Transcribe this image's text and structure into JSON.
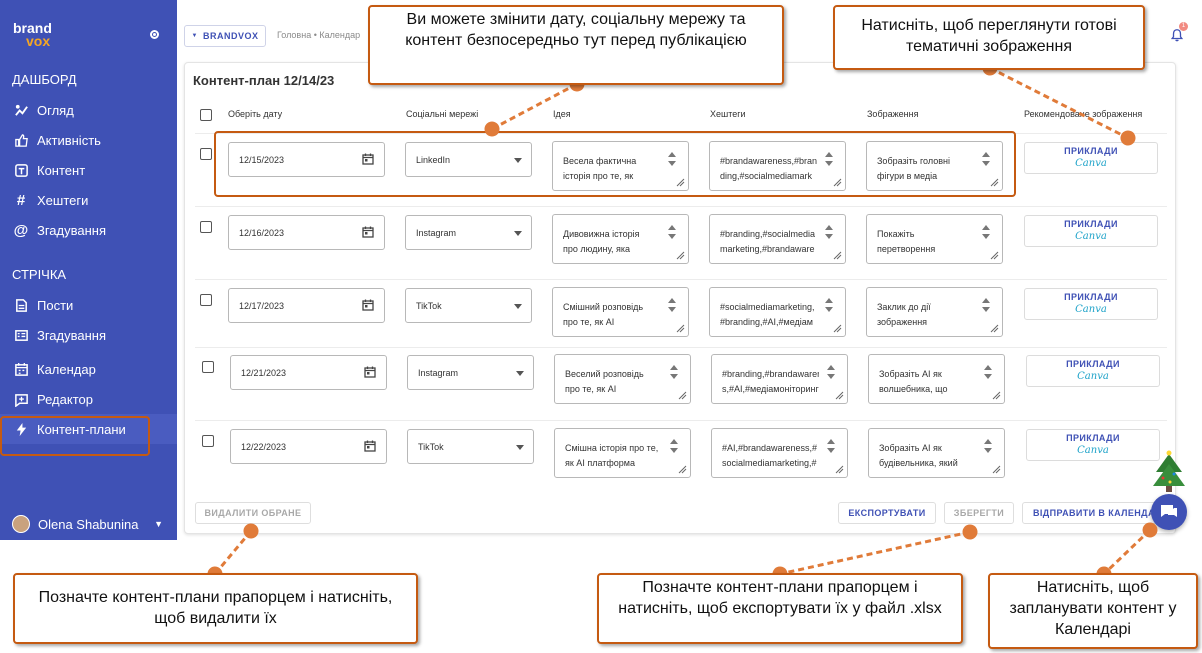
{
  "sidebar": {
    "logo_top": "brand",
    "logo_bottom": "vox",
    "section_dashboard": "ДАШБОРД",
    "section_feed": "СТРІЧКА",
    "items": [
      {
        "label": "Огляд",
        "icon": "overview-icon"
      },
      {
        "label": "Активність",
        "icon": "thumbs-up-icon"
      },
      {
        "label": "Контент",
        "icon": "content-icon"
      },
      {
        "label": "Хештеги",
        "icon": "hashtag-icon"
      },
      {
        "label": "Згадування",
        "icon": "at-icon"
      },
      {
        "label": "Пости",
        "icon": "posts-icon"
      },
      {
        "label": "Згадування",
        "icon": "mentions-list-icon"
      },
      {
        "label": "Календар",
        "icon": "calendar-icon"
      },
      {
        "label": "Редактор",
        "icon": "editor-icon"
      },
      {
        "label": "Контент-плани",
        "icon": "lightning-icon"
      }
    ],
    "user_name": "Olena Shabunina"
  },
  "topbar": {
    "brand_button": "BRANDVOX",
    "breadcrumb": "Головна • Календар",
    "notification_count": "1"
  },
  "content_plan": {
    "title": "Контент-план 12/14/23",
    "columns": [
      "Оберіть дату",
      "Соціальні мережі",
      "Ідея",
      "Хештеги",
      "Зображення",
      "Рекомендоване зображення"
    ],
    "rows": [
      {
        "date": "12/15/2023",
        "network": "LinkedIn",
        "idea": [
          "Весела фактична",
          "історія про те, як"
        ],
        "hashtags": [
          "#brandawareness,#bran",
          "ding,#socialmediamark"
        ],
        "image": [
          "Зобразіть головні",
          "фігури в медіа"
        ],
        "rec_label": "ПРИКЛАДИ",
        "rec_brand": "Canva"
      },
      {
        "date": "12/16/2023",
        "network": "Instagram",
        "idea": [
          "Дивовижна історія",
          "про людину, яка"
        ],
        "hashtags": [
          "#branding,#socialmedia",
          "marketing,#brandaware"
        ],
        "image": [
          "Покажіть",
          "перетворення"
        ],
        "rec_label": "ПРИКЛАДИ",
        "rec_brand": "Canva"
      },
      {
        "date": "12/17/2023",
        "network": "TikTok",
        "idea": [
          "Смішний розповідь",
          "про те, як AI"
        ],
        "hashtags": [
          "#socialmediamarketing,",
          "#branding,#AI,#медіам"
        ],
        "image": [
          "Заклик до дії",
          "зображення"
        ],
        "rec_label": "ПРИКЛАДИ",
        "rec_brand": "Canva"
      },
      {
        "date": "12/21/2023",
        "network": "Instagram",
        "idea": [
          "Веселий розповідь",
          "про те, як AI"
        ],
        "hashtags": [
          "#branding,#brandawarenes",
          "s,#AI,#медіамоніторинг"
        ],
        "image": [
          "Зобразіть AI як",
          "волшебника, що"
        ],
        "rec_label": "ПРИКЛАДИ",
        "rec_brand": "Canva"
      },
      {
        "date": "12/22/2023",
        "network": "TikTok",
        "idea": [
          "Смішна історія про те,",
          "як AI платформа"
        ],
        "hashtags": [
          "#AI,#brandawareness,#",
          "socialmediamarketing,#"
        ],
        "image": [
          "Зобразіть AI як",
          "будівельника, який"
        ],
        "rec_label": "ПРИКЛАДИ",
        "rec_brand": "Canva"
      }
    ],
    "buttons": {
      "delete": "ВИДАЛИТИ ОБРАНЕ",
      "export": "ЕКСПОРТУВАТИ",
      "save": "ЗБЕРЕГТИ",
      "send": "ВІДПРАВИТИ В КАЛЕНДАР"
    }
  },
  "callouts": {
    "edit_inline": "Ви можете змінити дату, соціальну мережу та контент безпосередньо тут перед публікацією",
    "view_images": "Натисніть, щоб переглянути готові тематичні зображення",
    "delete_hint": "Позначте контент-плани прапорцем і натисніть, щоб видалити їх",
    "export_hint": "Позначте контент-плани прапорцем і натисніть, щоб експортувати їх у файл .xlsx",
    "schedule_hint": "Натисніть, щоб запланувати контент у Календарі"
  },
  "colors": {
    "sidebar": "#3f51b5",
    "callout_border": "#c55a11",
    "canva": "#1fa3c9"
  }
}
